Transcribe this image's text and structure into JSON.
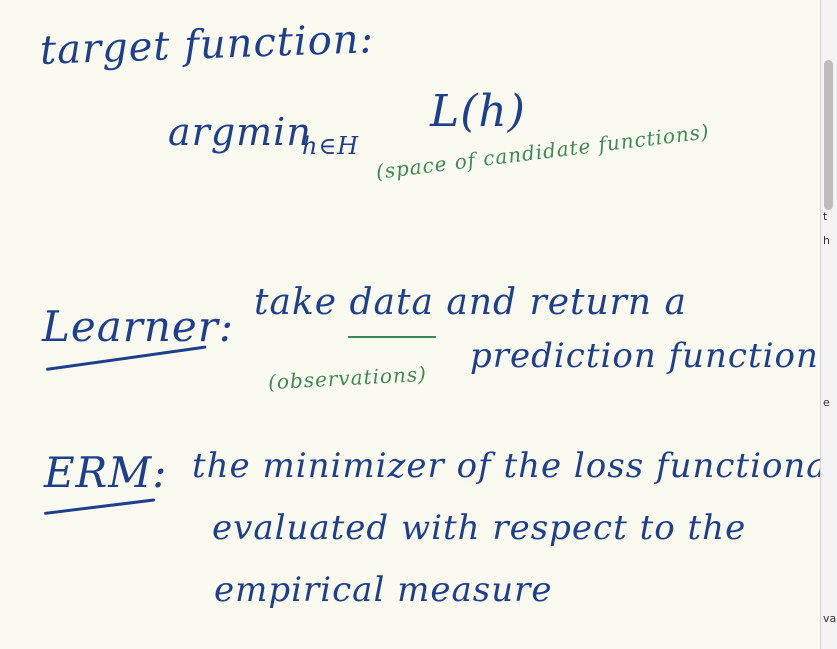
{
  "heading": "target function:",
  "formula": {
    "argmin": "argmin",
    "subscript": "h∈H",
    "loss": "L(h)",
    "note": "(space of candidate functions)"
  },
  "learner": {
    "label": "Learner:",
    "line1": "take data and return a",
    "note": "(observations)",
    "line2": "prediction function"
  },
  "erm": {
    "label": "ERM:",
    "line1": "the minimizer of the loss functional",
    "line2": "evaluated with respect to the",
    "line3": "empirical measure"
  },
  "edge_fragments": [
    "t",
    "h",
    "e",
    "va"
  ]
}
